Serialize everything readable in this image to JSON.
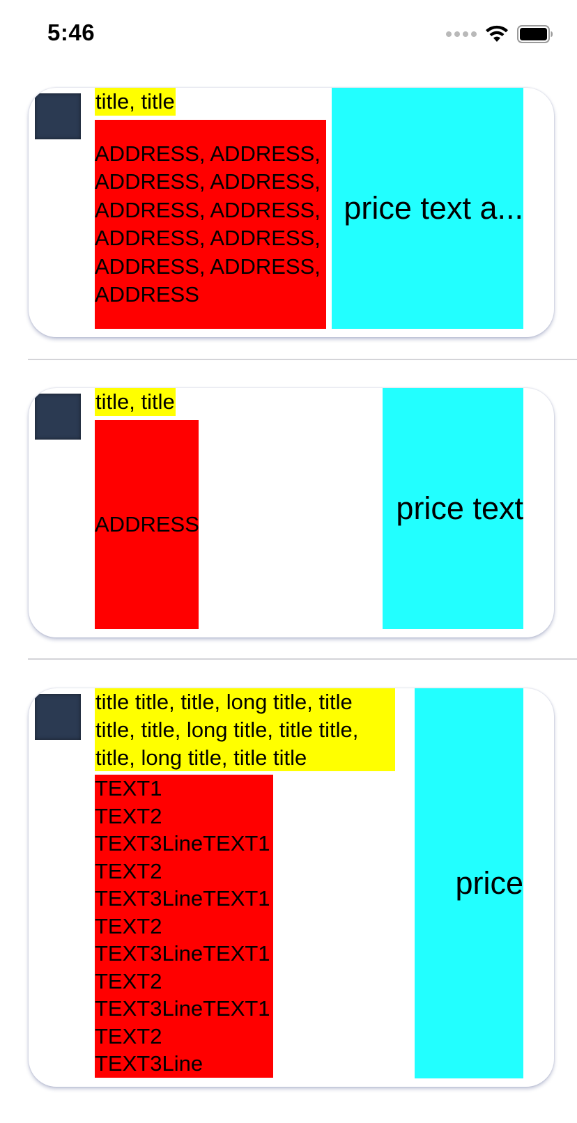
{
  "status_bar": {
    "time": "5:46"
  },
  "cards": [
    {
      "title": "title, title",
      "address": "ADDRESS, ADDRESS,\nADDRESS, ADDRESS,\nADDRESS, ADDRESS,\nADDRESS, ADDRESS,\nADDRESS, ADDRESS,\nADDRESS",
      "price": "price text a..."
    },
    {
      "title": "title, title",
      "address": "ADDRESS",
      "price": "price text"
    },
    {
      "title": "title title, title, long title, title\ntitle, title, long title, title title,\ntitle, long title, title title",
      "address": "TEXT1\nTEXT2\nTEXT3LineTEXT1\nTEXT2\nTEXT3LineTEXT1\nTEXT2\nTEXT3LineTEXT1\nTEXT2\nTEXT3LineTEXT1\nTEXT2\nTEXT3Line",
      "price": "price"
    }
  ],
  "colors": {
    "title_bg": "#ffff00",
    "address_bg": "#ff0000",
    "price_bg": "#22ffff",
    "thumbnail": "#2b3a52"
  }
}
